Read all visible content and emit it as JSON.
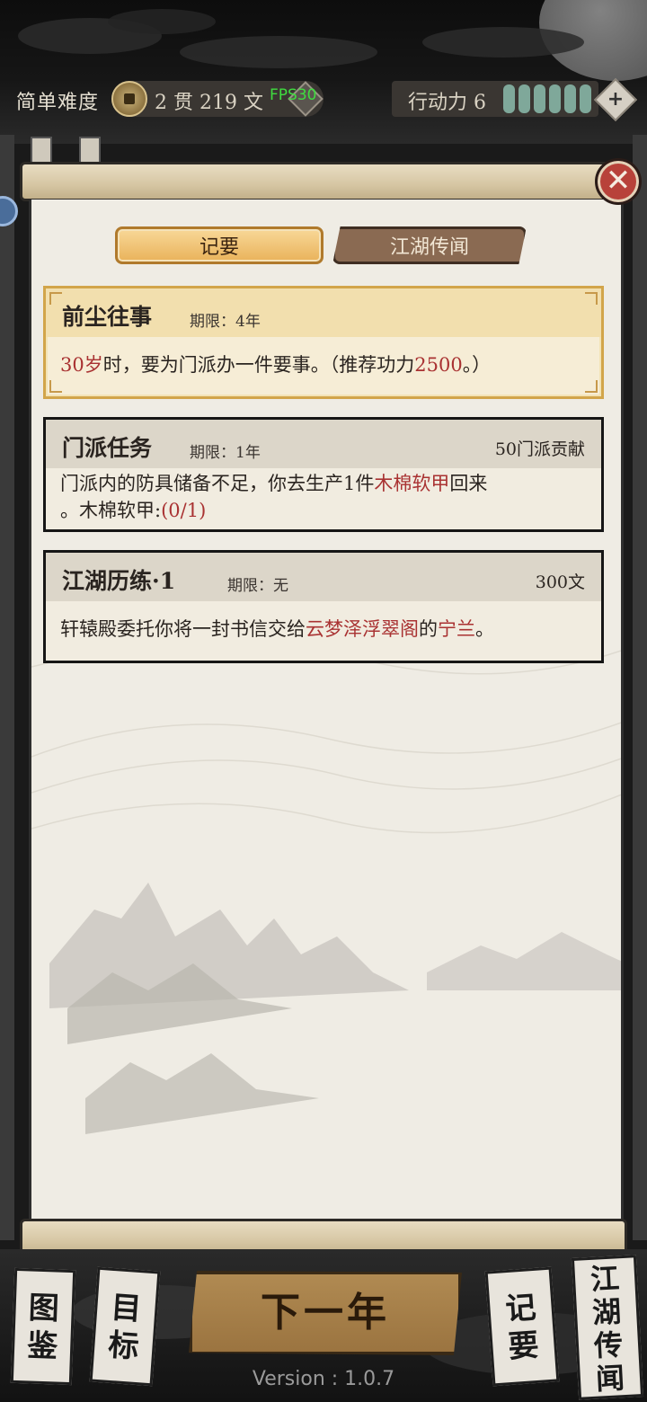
{
  "header": {
    "difficulty": "简单难度",
    "currency_text": "2 贯  219 文",
    "fps": "FPS30",
    "action_label": "行动力 6",
    "action_points": 6
  },
  "tabs": [
    {
      "label": "记要",
      "active": true
    },
    {
      "label": "江湖传闻",
      "active": false
    }
  ],
  "tasks": {
    "past": {
      "title": "前尘往事",
      "deadline": "期限：4年",
      "desc_age": "30岁",
      "desc_mid": "时，要为门派办一件要事。（推荐功力",
      "desc_power": "2500",
      "desc_end": "。）"
    },
    "sect": {
      "title": "门派任务",
      "deadline": "期限：1年",
      "reward": "50门派贡献",
      "desc_a": "门派内的防具储备不足，你去生产1件",
      "desc_item": "木棉软甲",
      "desc_b": "回来",
      "desc_c": "。木棉软甲:",
      "desc_progress": "(0/1)"
    },
    "training": {
      "title": "江湖历练·1",
      "deadline": "期限：无",
      "reward": "300文",
      "desc_a": "轩辕殿委托你将一封书信交给",
      "desc_place": "云梦泽浮翠阁",
      "desc_b": "的",
      "desc_person": "宁兰",
      "desc_end": "。"
    }
  },
  "bottom": {
    "atlas": "图鉴",
    "goals": "目标",
    "next_year": "下一年",
    "notes": "记要",
    "rumors": "江湖传闻",
    "version": "Version : 1.0.7"
  },
  "colors": {
    "highlight_red": "#a93232",
    "tab_active": "#e9b25a",
    "close_button": "#b8423a",
    "action_bar": "#7fa89a"
  }
}
